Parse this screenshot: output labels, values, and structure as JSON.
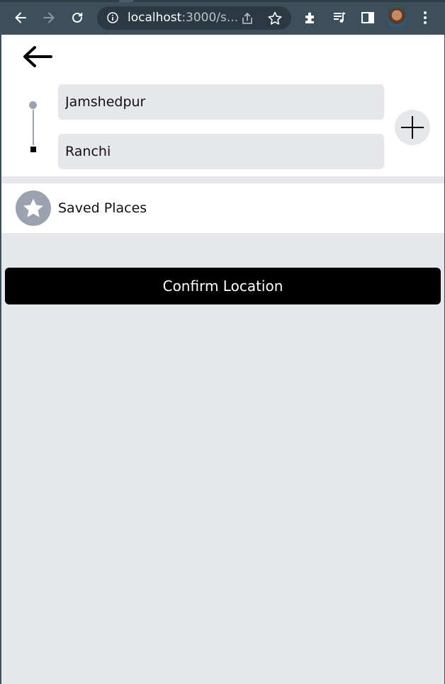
{
  "browser": {
    "url_host": "localhost",
    "url_rest": ":3000/s..."
  },
  "page": {
    "pickup": {
      "value": "Jamshedpur"
    },
    "dropoff": {
      "value": "Ranchi"
    },
    "saved_places_label": "Saved Places",
    "confirm_label": "Confirm Location"
  },
  "icons": {
    "back": "back-arrow-icon",
    "add": "plus-icon",
    "saved": "star-icon"
  },
  "colors": {
    "chrome_bg": "#3d4f5a",
    "page_bg": "#e5e7eb",
    "input_bg": "#e5e7eb",
    "accent_gray": "#9ca3af",
    "button_bg": "#000000",
    "button_text": "#ffffff"
  }
}
